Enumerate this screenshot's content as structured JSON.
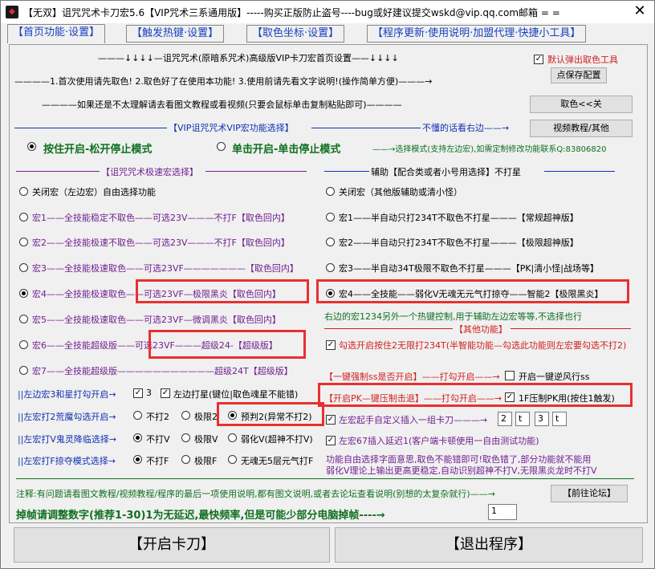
{
  "window": {
    "title": "【无双】诅咒咒术卡刀宏5.6【VIP咒术三系通用版】-----购买正版防止盗号----bug或好建议提交wskd@vip.qq.com邮箱 = =",
    "close_glyph": "✕"
  },
  "tabs": [
    {
      "label": "【首页功能·设置】"
    },
    {
      "label": "【触发热键·设置】"
    },
    {
      "label": "【取色坐标·设置】"
    },
    {
      "label": "【程序更新·使用说明·加盟代理·快捷小工具】"
    }
  ],
  "header": {
    "line1": "———↓↓↓↓—诅咒咒术(原暗系咒术)高级版VIP卡刀宏首页设置——↓↓↓↓",
    "line2": "————1.首次使用请先取色!  2.取色好了在使用本功能!   3.使用前请先看文字说明!(操作简单方便)———→",
    "line3": "————如果还是不太理解请去看图文教程或看视频(只要会鼠标单击复制粘贴即可)————",
    "line4": "【VIP诅咒咒术VIP宏功能选择】",
    "line4_right": "不懂的话看右边——→"
  },
  "right_panel": {
    "auto_popup_label": "默认弹出取色工具",
    "save_button": "点保存配置",
    "pick_color_button": "取色<<关",
    "video_button": "视频教程/其他"
  },
  "mode": {
    "hold_label": "按住开启-松开停止模式",
    "click_label": "单击开启-单击停止模式",
    "note": "——→选择模式(支持左边宏),如需定制修改功能联系Q:83806820"
  },
  "left_group": {
    "title": "【诅咒咒术极速宏选择】",
    "items": [
      {
        "label": "关闭宏（左边宏）自由选择功能",
        "suffix": ""
      },
      {
        "label": "宏1——全技能稳定不取色——可选23V———不打F【取色回内】",
        "suffix": ""
      },
      {
        "label": "宏2——全技能极速不取色——可选23V———不打F【取色回内】",
        "suffix": ""
      },
      {
        "label": "宏3——全技能极速取色——可选23VF———————【取色回内】",
        "suffix": ""
      },
      {
        "label": "宏4——全技能极速取色——可选23VF—极限黑炎【取色回内】",
        "suffix": ""
      },
      {
        "label": "宏5——全技能极速取色——可选23VF—微调黑炎【取色回内】",
        "suffix": ""
      },
      {
        "label": "宏6——全技能超级版——可选23VF———超级24-【超级版】",
        "suffix": ""
      },
      {
        "label": "宏7——全技能超级版———————————超级24T【超级版】",
        "suffix": ""
      }
    ]
  },
  "right_group": {
    "title": "辅助【配合类或者小号用选择】不打星",
    "items": [
      {
        "label": "关闭宏（其他版辅助或清小怪）"
      },
      {
        "label": "宏1——半自动只打234T不取色不打星———【常规超神版】"
      },
      {
        "label": "宏2——半自动只打234T不取色不打星———【极限超神版】"
      },
      {
        "label": "宏3——半自动34T极限不取色不打星———【PK|清小怪|战场等】"
      },
      {
        "label": "宏4——全技能——弱化V无魂无元气打掠夺——智能2【极限黑炎】"
      }
    ],
    "note": "右边的宏1234另外一个热键控制,用于辅助左边宏等等,不选择也行",
    "other_title": "【其他功能】",
    "other_1": "勾选开启按住2无限打234T(半智能功能—勾选此功能则左宏要勾选不打2)",
    "oneclick_ss": "【一键强制ss是否开启】——打勾开启——→",
    "oneclick_ss_cb": "开启一键逆风行ss",
    "pk_line": "【开启PK—键压制击退】——打勾开启——→",
    "pk_cb": "1F压制PK用(按住1触发)",
    "custom_insert": "左宏起手自定义插入一组卡刀———→",
    "custom_keys": [
      "2",
      "t",
      "3",
      "t"
    ],
    "delay_67": "左宏67插入延迟1(客户端卡顿使用一自由测试功能)",
    "explain_1": "功能自由选择字面意思,取色不能错即可!取色错了,部分功能就不能用",
    "explain_2": "弱化V理论上输出更高更稳定,自动识别超神不打V,无限黑炎龙时不打V"
  },
  "options": {
    "row1_label": "||左边宏3和星打勾开启→",
    "row1_cb1": "3",
    "row1_cb2": "左边打星(键位|取色魂星不能错)",
    "row2_label": "||左宏打2荒魔勾选开启→",
    "row2_opts": [
      "不打2",
      "极限2",
      "预判2(异常不打2)"
    ],
    "row3_label": "||左宏打V鬼灵降临选择→",
    "row3_opts": [
      "不打V",
      "极限V",
      "弱化V(超神不打V)"
    ],
    "row4_label": "||左宏打F掠夺模式选择→",
    "row4_opts": [
      "不打F",
      "极限F",
      "无魂无5层元气打F"
    ]
  },
  "footer": {
    "note": "注释:有问题请看图文教程/视频教程/程序的最后一项使用说明,都有图文说明,或者去论坛查看说明(别想的太复杂就行)——→",
    "forum_button": "【前往论坛】",
    "frame_label": "掉帧请调整数字(推荐1-30)1为无延迟,最快频率,但是可能少部分电脑掉帧----→",
    "frame_value": "1",
    "start_button": "【开启卡刀】",
    "exit_button": "【退出程序】"
  },
  "colors": {
    "accent_blue": "#1030b0",
    "red": "#d02020",
    "purple": "#702090",
    "green": "#107020",
    "highlight": "#e83030"
  }
}
